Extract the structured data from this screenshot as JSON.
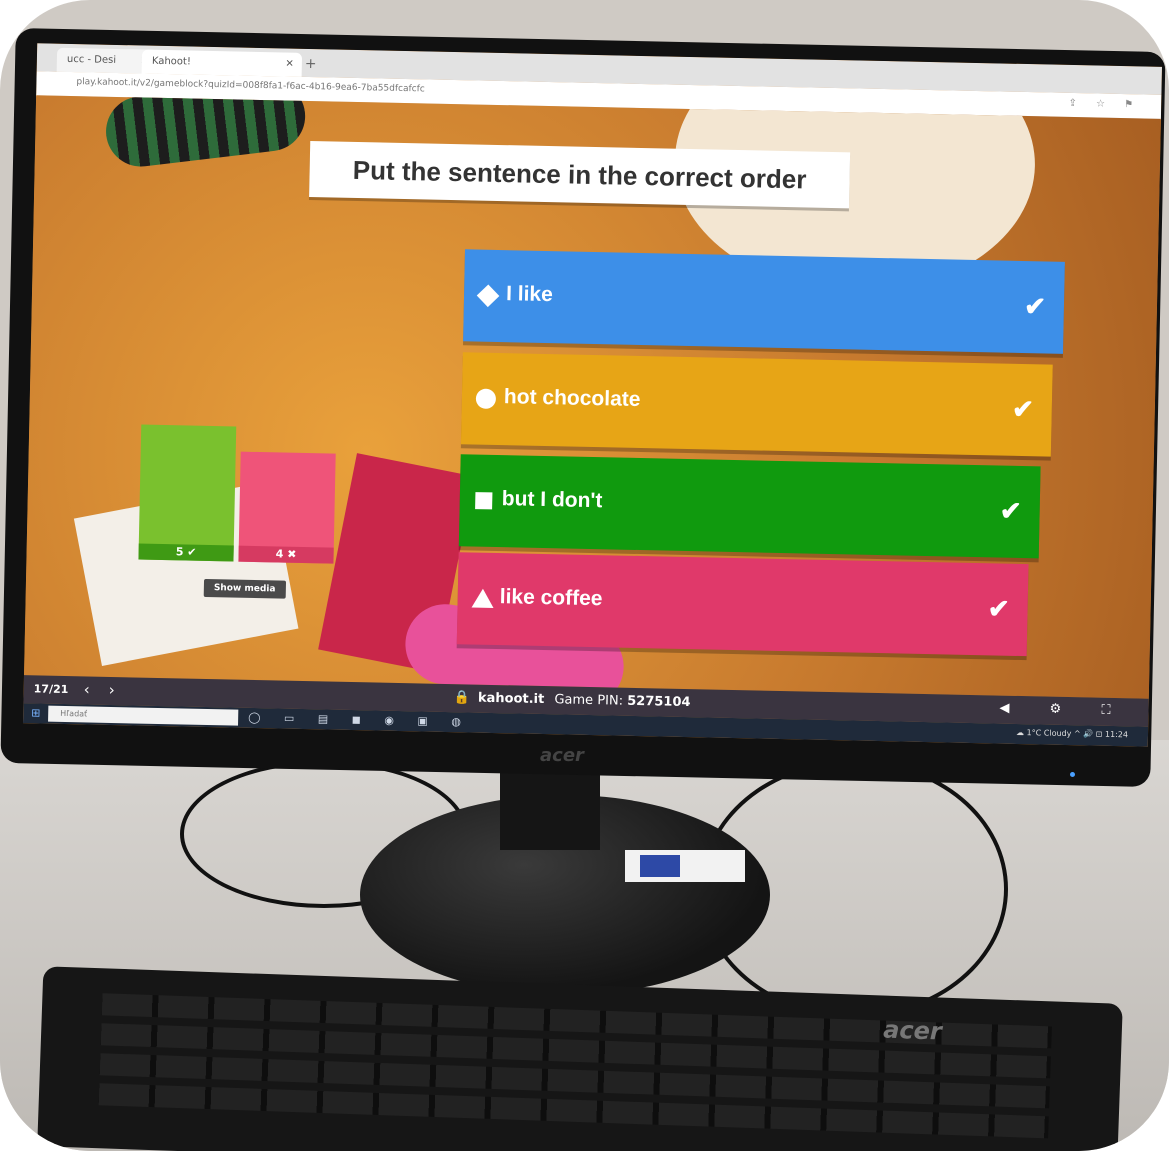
{
  "browser": {
    "tabs": [
      {
        "label": "ucc - Desi"
      },
      {
        "label": "Kahoot!"
      }
    ],
    "newtab_icon": "+",
    "url": "play.kahoot.it/v2/gameblock?quizId=008f8fa1-f6ac-4b16-9ea6-7ba55dfcafcfc",
    "icons": "⇪ ☆ ⚑"
  },
  "game": {
    "question": "Put the sentence in the correct order",
    "answers": [
      {
        "label": "I like",
        "shape": "diamond-icon",
        "color": "#3d8fe8",
        "check": "✔"
      },
      {
        "label": "hot chocolate",
        "shape": "circle-icon",
        "color": "#e7a516",
        "check": "✔"
      },
      {
        "label": "but I don't",
        "shape": "square-icon",
        "color": "#109a0e",
        "check": "✔"
      },
      {
        "label": "like coffee",
        "shape": "triangle-icon",
        "color": "#e0396a",
        "check": "✔"
      }
    ],
    "results": {
      "correct_label": "5 ✔",
      "incorrect_label": "4 ✖",
      "correct_count": 5,
      "incorrect_count": 4
    },
    "show_media_label": "Show media",
    "footer": {
      "counter": "17/21",
      "prev": "‹",
      "next": "›",
      "lock": "🔒",
      "brand": "kahoot.it",
      "pin_label": "Game PIN:",
      "pin_value": "5275104",
      "controls": "◀ ⚙ ⛶"
    }
  },
  "taskbar": {
    "start": "⊞",
    "search_placeholder": "Hľadať",
    "apps": "◯ ▭ ▤ ◼ ◉ ▣ ◍",
    "tray": "☁ 1°C Cloudy  ^ 🔊 ⊡ 11:24"
  },
  "hardware": {
    "monitor_brand": "acer",
    "keyboard_brand": "acer"
  }
}
